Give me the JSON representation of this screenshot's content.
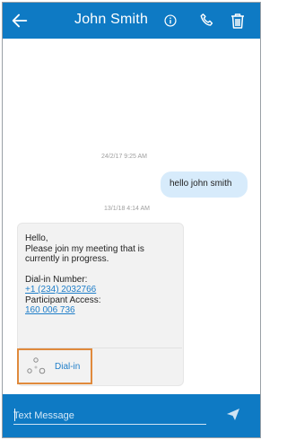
{
  "header": {
    "title": "John Smith",
    "icons": [
      "back-arrow-icon",
      "info-icon",
      "phone-icon",
      "trash-icon"
    ]
  },
  "messages": [
    {
      "direction": "outgoing",
      "timestamp": "24/2/17  9:25 AM",
      "text": "hello john smith"
    },
    {
      "direction": "incoming",
      "timestamp": "13/1/18  4:14 AM",
      "greeting": "Hello,",
      "body_line1": "Please join my meeting that is",
      "body_line2": "currently in progress.",
      "dialin_label": "Dial-in Number:",
      "dialin_number": "+1 (234) 2032766",
      "participant_label": "Participant Access:",
      "participant_code": "160 006 736",
      "action_label": "Dial-in"
    }
  ],
  "composer": {
    "placeholder": "Text Message",
    "send_icon": "send-icon"
  },
  "colors": {
    "brand": "#0e7ac4",
    "outgoing_bubble": "#d7ebfb",
    "incoming_bubble": "#f2f2f2",
    "link": "#1f7ec9",
    "highlight": "#e08a3c"
  }
}
